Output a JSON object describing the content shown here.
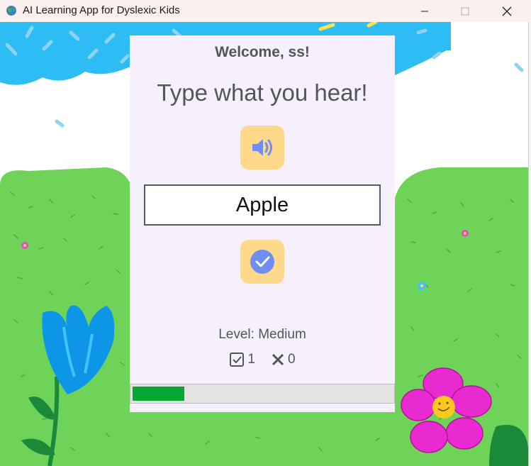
{
  "window": {
    "title": "AI Learning App for Dyslexic Kids",
    "minimize_label": "Minimize",
    "maximize_label": "Maximize",
    "close_label": "Close"
  },
  "card": {
    "welcome": "Welcome, ss!",
    "prompt": "Type what you hear!",
    "speak_icon": "speaker-icon",
    "answer_value": "Apple",
    "check_icon": "checkmark-circle-icon",
    "level_text": "Level: Medium",
    "correct_count": "1",
    "wrong_count": "0",
    "progress_fraction": 0.2
  },
  "colors": {
    "card_bg": "#f6f0fd",
    "button_bg": "#ffd98a",
    "icon_blue": "#6e8ef5",
    "progress_fill": "#07a831",
    "sky": "#2ebcf4",
    "grass": "#6fd35a"
  }
}
